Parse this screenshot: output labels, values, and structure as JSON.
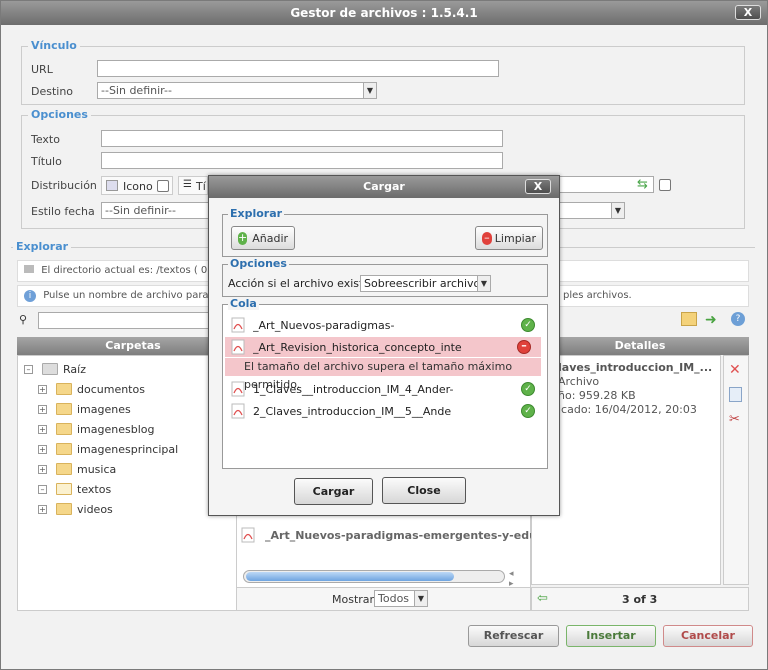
{
  "window": {
    "title": "Gestor de archivos : 1.5.4.1",
    "close_label": "X"
  },
  "vinculo": {
    "legend": "Vínculo",
    "url_label": "URL",
    "url_value": "",
    "destino_label": "Destino",
    "destino_value": "--Sin definir--"
  },
  "opciones": {
    "legend": "Opciones",
    "texto_label": "Texto",
    "titulo_label": "Título",
    "distribucion_label": "Distribución",
    "icono_label": "Icono",
    "partial_label": "Tí",
    "estilo_label": "Estilo fecha",
    "estilo_value": "--Sin definir--"
  },
  "explorar": {
    "legend": "Explorar",
    "dir_text": "El directorio actual es: /textos ( 0 ca",
    "info_text": "Pulse un nombre de archivo para inse",
    "info_text_right": "ples archivos.",
    "carpetas_header": "Carpetas",
    "detalles_header": "Detalles",
    "tree": [
      {
        "name": "Raíz",
        "expander": "–"
      },
      {
        "name": "documentos",
        "expander": "+"
      },
      {
        "name": "imagenes",
        "expander": "+"
      },
      {
        "name": "imagenesblog",
        "expander": "+"
      },
      {
        "name": "imagenesprincipal",
        "expander": "+"
      },
      {
        "name": "musica",
        "expander": "+"
      },
      {
        "name": "textos",
        "expander": "–"
      },
      {
        "name": "videos",
        "expander": "+"
      }
    ],
    "file_partial": "_Art_Nuevos-paradigmas-emergentes-y-educa",
    "mostrar_label": "Mostrar",
    "mostrar_value": "Todos",
    "details_title": "laves_introduccion_IM_...",
    "details_type": "Archivo",
    "details_size": "ño: 959.28 KB",
    "details_date": "icado: 16/04/2012, 20:03",
    "pager": "3 of 3"
  },
  "buttons": {
    "refrescar": "Refrescar",
    "insertar": "Insertar",
    "cancelar": "Cancelar"
  },
  "dialog": {
    "title": "Cargar",
    "close_label": "X",
    "explorar_legend": "Explorar",
    "anadir_label": "Añadir",
    "limpiar_label": "Limpiar",
    "opciones_legend": "Opciones",
    "accion_label": "Acción si el archivo existe:",
    "accion_value": "Sobreescribir archivo",
    "cola_legend": "Cola",
    "queue": [
      {
        "name": "_Art_Nuevos-paradigmas-",
        "status": "ok"
      },
      {
        "name": "_Art_Revision_historica_concepto_inte",
        "status": "error"
      },
      {
        "name": "1_Claves__introduccion_IM_4_Ander-",
        "status": "ok"
      },
      {
        "name": "2_Claves_introduccion_IM__5__Ande",
        "status": "ok"
      }
    ],
    "error_message": "El tamaño del archivo supera el tamaño máximo permitido.",
    "cargar_label": "Cargar",
    "close_button_label": "Close"
  }
}
